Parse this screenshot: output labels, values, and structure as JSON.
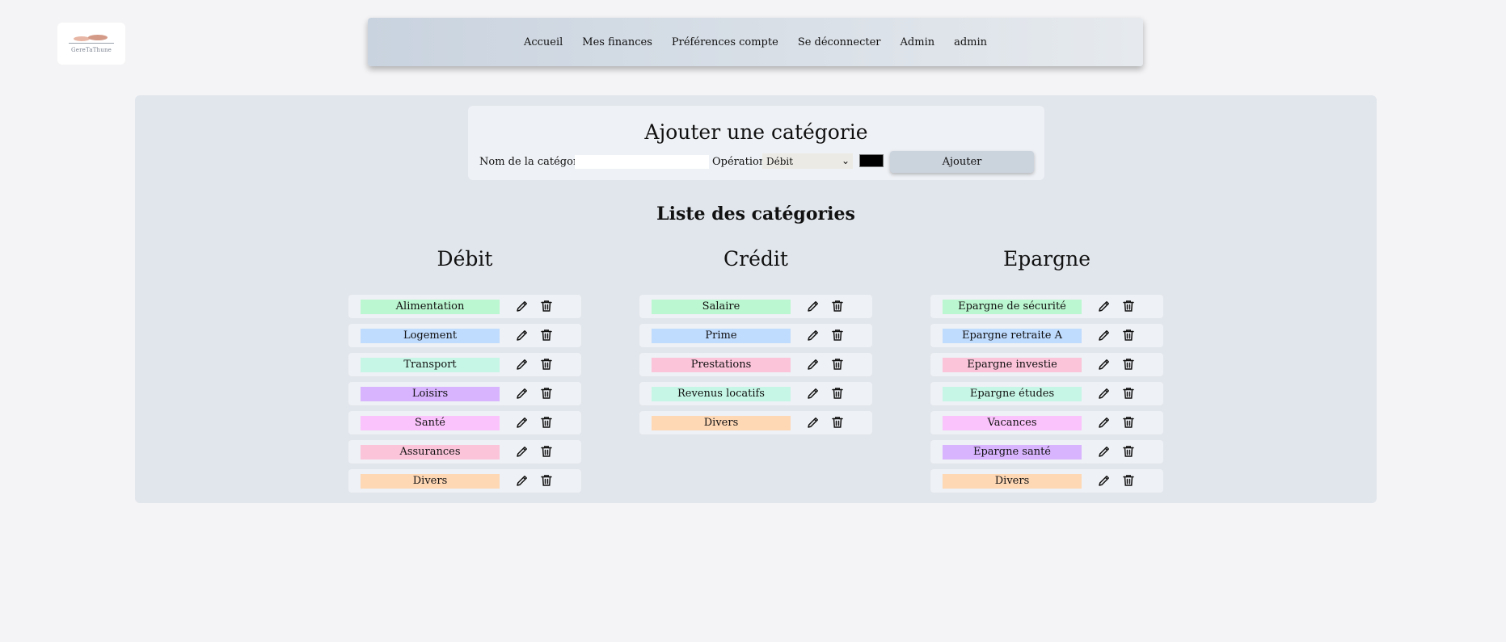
{
  "logo": {
    "text": "GereTaThune"
  },
  "nav": {
    "items": [
      "Accueil",
      "Mes finances",
      "Préférences compte",
      "Se déconnecter",
      "Admin",
      "admin"
    ]
  },
  "add_form": {
    "title": "Ajouter une catégorie",
    "name_label": "Nom de la catégorie",
    "name_value": "",
    "operation_label": "Opération",
    "operation_value": "Débit",
    "color_value": "#000000",
    "submit_label": "Ajouter"
  },
  "list": {
    "title": "Liste des catégories",
    "columns": [
      {
        "title": "Débit",
        "items": [
          {
            "label": "Alimentation",
            "color": "#bbf7d0"
          },
          {
            "label": "Logement",
            "color": "#bfdbfe"
          },
          {
            "label": "Transport",
            "color": "#c6f6e6"
          },
          {
            "label": "Loisirs",
            "color": "#d8b4fe"
          },
          {
            "label": "Santé",
            "color": "#fbc3fb"
          },
          {
            "label": "Assurances",
            "color": "#fbc4d9"
          },
          {
            "label": "Divers",
            "color": "#fed7b5"
          }
        ]
      },
      {
        "title": "Crédit",
        "items": [
          {
            "label": "Salaire",
            "color": "#bbf7d0"
          },
          {
            "label": "Prime",
            "color": "#bfdbfe"
          },
          {
            "label": "Prestations",
            "color": "#fbc4d9"
          },
          {
            "label": "Revenus locatifs",
            "color": "#c6f6e6"
          },
          {
            "label": "Divers",
            "color": "#fed7b5"
          }
        ]
      },
      {
        "title": "Epargne",
        "items": [
          {
            "label": "Epargne de sécurité",
            "color": "#bbf7d0"
          },
          {
            "label": "Epargne retraite A",
            "color": "#bfdbfe"
          },
          {
            "label": "Epargne investie",
            "color": "#fbc4d9"
          },
          {
            "label": "Epargne études",
            "color": "#c6f6e6"
          },
          {
            "label": "Vacances",
            "color": "#fbc3fb"
          },
          {
            "label": "Epargne santé",
            "color": "#d8b4fe"
          },
          {
            "label": "Divers",
            "color": "#fed7b5"
          }
        ]
      }
    ]
  }
}
